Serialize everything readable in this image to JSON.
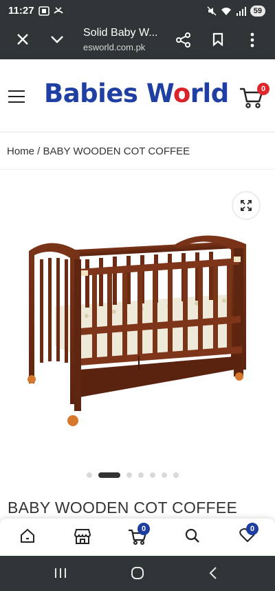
{
  "status_bar": {
    "time": "11:27",
    "battery": "59"
  },
  "browser": {
    "page_title": "Solid Baby W...",
    "url": "esworld.com.pk"
  },
  "site": {
    "logo_part1": "Babies W",
    "logo_o": "o",
    "logo_part2": "rld",
    "cart_count": "0"
  },
  "breadcrumb": {
    "home": "Home",
    "separator": " / ",
    "current": "BABY WOODEN COT COFFEE"
  },
  "product": {
    "title": "BABY WOODEN COT COFFEE",
    "gallery_image_count": 7,
    "active_image_index": 1
  },
  "bottom_nav": {
    "cart_count": "0",
    "wishlist_count": "0"
  },
  "colors": {
    "brand_blue": "#1f3fa3",
    "brand_red": "#d8232a",
    "badge_red": "#e0252b",
    "badge_blue": "#1d3e9e",
    "system_bar": "#2f3437"
  }
}
